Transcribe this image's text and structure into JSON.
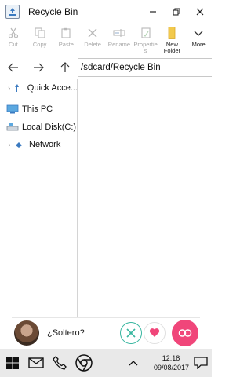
{
  "window": {
    "title": "Recycle Bin",
    "icon": "recycle-bin-icon",
    "controls": [
      "minimize-icon",
      "restore-icon",
      "close-icon"
    ]
  },
  "ribbon": {
    "items": [
      {
        "label": "Cut",
        "icon": "cut-icon",
        "enabled": false
      },
      {
        "label": "Copy",
        "icon": "copy-icon",
        "enabled": false
      },
      {
        "label": "Paste",
        "icon": "paste-icon",
        "enabled": false
      },
      {
        "label": "Delete",
        "icon": "delete-icon",
        "enabled": false
      },
      {
        "label": "Rename",
        "icon": "rename-icon",
        "enabled": false
      },
      {
        "label": "Propertie\ns",
        "icon": "properties-icon",
        "enabled": false
      },
      {
        "label": "New\nFolder",
        "icon": "new-folder-icon",
        "enabled": true
      },
      {
        "label": "More",
        "icon": "more-icon",
        "enabled": true
      }
    ]
  },
  "nav": {
    "back_icon": "arrow-left-icon",
    "forward_icon": "arrow-right-icon",
    "up_icon": "arrow-up-icon",
    "path": "/sdcard/Recycle Bin"
  },
  "sidebar": {
    "items": [
      {
        "label": "Quick Acce...",
        "icon": "pin-icon",
        "expandable": true
      },
      {
        "label": "This PC",
        "icon": "computer-icon",
        "expandable": false
      },
      {
        "label": "Local Disk(C:)",
        "icon": "drive-icon",
        "expandable": true
      },
      {
        "label": "Network",
        "icon": "network-icon",
        "expandable": true
      }
    ]
  },
  "ad": {
    "text": "¿Soltero?",
    "accent": "#f0467a",
    "x_color": "#38b6a0"
  },
  "taskbar": {
    "time": "12:18",
    "date": "09/08/2017"
  },
  "colors": {
    "disabled_label": "#a8a8a8",
    "taskbar_bg": "#e9e9e9",
    "folder_yellow": "#f2c94c"
  }
}
